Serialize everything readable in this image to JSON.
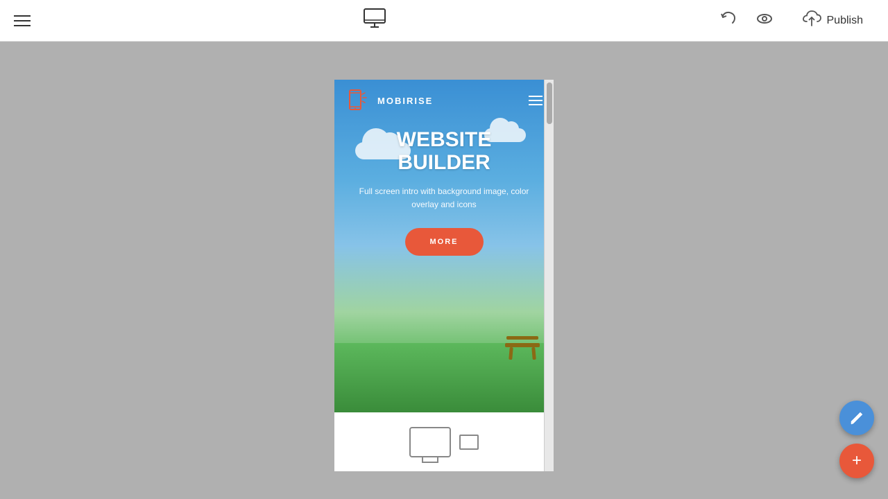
{
  "toolbar": {
    "publish_label": "Publish",
    "menu_icon_label": "menu",
    "monitor_icon_label": "monitor",
    "undo_icon_label": "undo",
    "eye_icon_label": "preview",
    "cloud_icon_label": "cloud-upload"
  },
  "preview": {
    "logo_text": "MOBIRISE",
    "hero": {
      "title_line1": "WEBSITE",
      "title_line2": "BUILDER",
      "subtitle": "Full screen intro with background image, color overlay and icons",
      "cta_label": "MORE"
    }
  },
  "fabs": {
    "edit_label": "✏",
    "add_label": "+"
  },
  "colors": {
    "accent_red": "#e8583a",
    "accent_blue": "#4a90d9",
    "toolbar_bg": "#ffffff",
    "canvas_bg": "#b0b0b0"
  }
}
